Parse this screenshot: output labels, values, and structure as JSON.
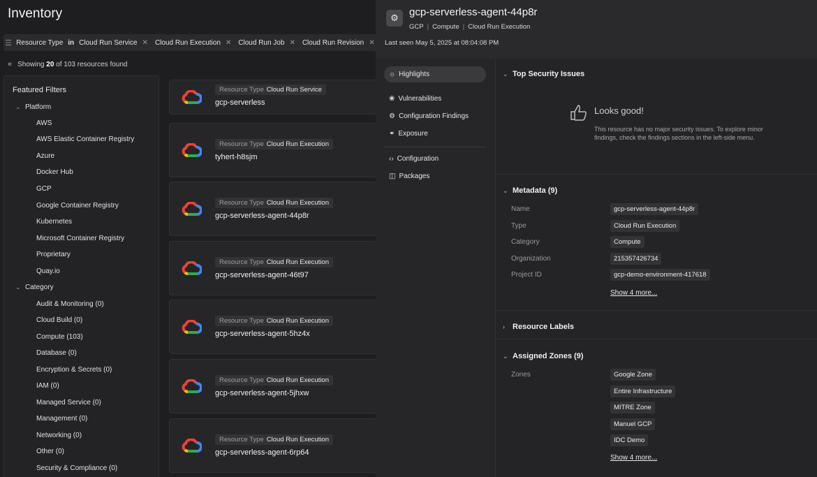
{
  "inventory": {
    "title": "Inventory",
    "filter": {
      "field": "Resource Type",
      "op": "in",
      "values": [
        "Cloud Run Service",
        "Cloud Run Execution",
        "Cloud Run Job",
        "Cloud Run Revision"
      ]
    },
    "showing": {
      "prefix": "Showing",
      "count": "20",
      "mid": "of",
      "total": "103",
      "suffix": "resources found"
    },
    "featured_filters": {
      "title": "Featured Filters",
      "platform": {
        "label": "Platform",
        "items": [
          "AWS",
          "AWS Elastic Container Registry",
          "Azure",
          "Docker Hub",
          "GCP",
          "Google Container Registry",
          "Kubernetes",
          "Microsoft Container Registry",
          "Proprietary",
          "Quay.io"
        ]
      },
      "category": {
        "label": "Category",
        "items": [
          "Audit & Monitoring (0)",
          "Cloud Build (0)",
          "Compute (103)",
          "Database (0)",
          "Encryption & Secrets (0)",
          "IAM (0)",
          "Managed Service (0)",
          "Management (0)",
          "Networking (0)",
          "Other (0)",
          "Security & Compliance (0)"
        ]
      }
    },
    "cards": [
      {
        "type_label": "Resource Type",
        "type": "Cloud Run Service",
        "name": "gcp-serverless"
      },
      {
        "type_label": "Resource Type",
        "type": "Cloud Run Execution",
        "name": "tyhert-h8sjm"
      },
      {
        "type_label": "Resource Type",
        "type": "Cloud Run Execution",
        "name": "gcp-serverless-agent-44p8r"
      },
      {
        "type_label": "Resource Type",
        "type": "Cloud Run Execution",
        "name": "gcp-serverless-agent-46t97"
      },
      {
        "type_label": "Resource Type",
        "type": "Cloud Run Execution",
        "name": "gcp-serverless-agent-5hz4x"
      },
      {
        "type_label": "Resource Type",
        "type": "Cloud Run Execution",
        "name": "gcp-serverless-agent-5jhxw"
      },
      {
        "type_label": "Resource Type",
        "type": "Cloud Run Execution",
        "name": "gcp-serverless-agent-6rp64"
      }
    ]
  },
  "detail": {
    "title": "gcp-serverless-agent-44p8r",
    "breadcrumb": [
      "GCP",
      "Compute",
      "Cloud Run Execution"
    ],
    "last_seen": "Last seen May 5, 2025 at 08:04:08 PM",
    "nav": {
      "highlights": "Highlights",
      "vulnerabilities": "Vulnerabilities",
      "config_findings": "Configuration Findings",
      "exposure": "Exposure",
      "configuration": "Configuration",
      "packages": "Packages"
    },
    "top_security": {
      "title": "Top Security Issues",
      "status_title": "Looks good!",
      "status_text": "This resource has no major security issues. To explore minor findings, check the findings sections in the left-side menu."
    },
    "metadata": {
      "title": "Metadata (9)",
      "rows": [
        {
          "key": "Name",
          "value": "gcp-serverless-agent-44p8r"
        },
        {
          "key": "Type",
          "value": "Cloud Run Execution"
        },
        {
          "key": "Category",
          "value": "Compute"
        },
        {
          "key": "Organization",
          "value": "215357426734"
        },
        {
          "key": "Project ID",
          "value": "gcp-demo-environment-417618"
        }
      ],
      "more": "Show 4 more..."
    },
    "resource_labels": {
      "title": "Resource Labels"
    },
    "zones": {
      "title": "Assigned Zones (9)",
      "key": "Zones",
      "values": [
        "Google Zone",
        "Entire Infrastructure",
        "MITRE Zone",
        "Manuel GCP",
        "IDC Demo"
      ],
      "more": "Show 4 more..."
    }
  },
  "colors": {
    "gcp_red": "#ea4335",
    "gcp_yellow": "#fbbc04",
    "gcp_blue": "#4285f4",
    "gcp_green": "#34a853"
  }
}
